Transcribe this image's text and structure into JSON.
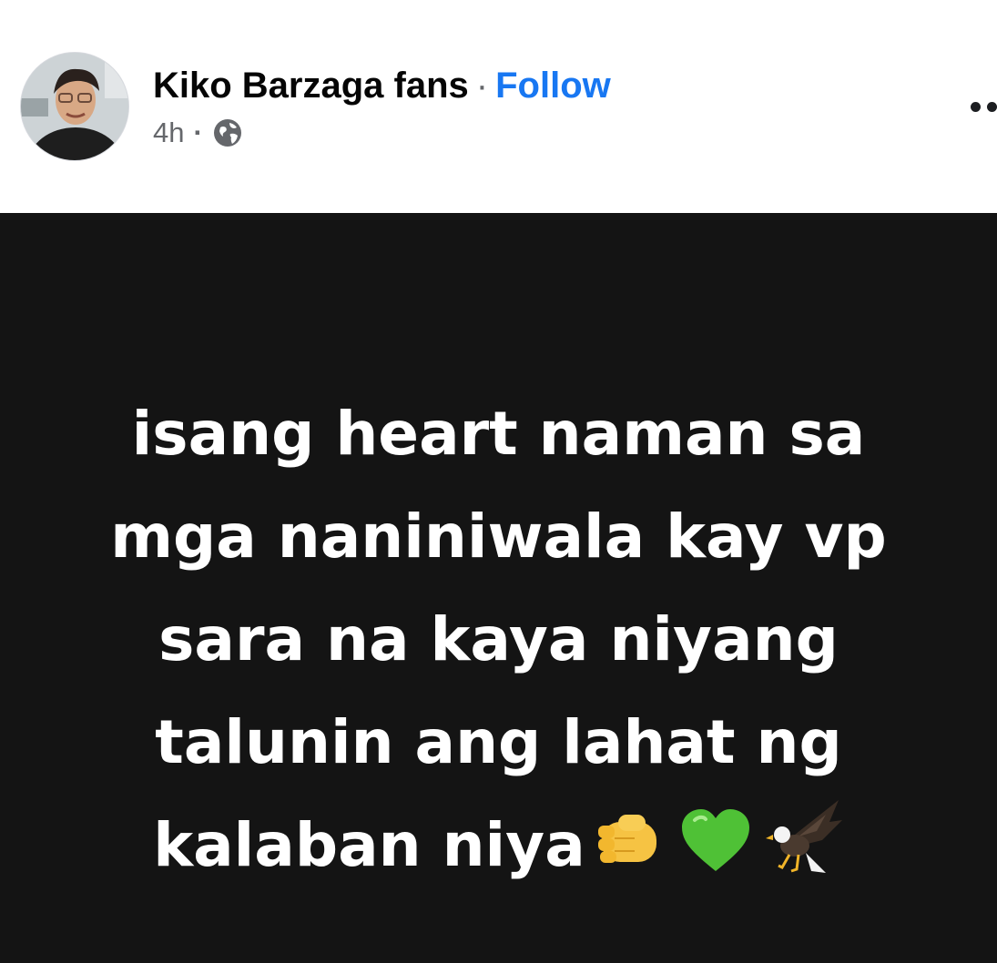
{
  "post": {
    "page_name": "Kiko Barzaga fans",
    "separator": "·",
    "follow_label": "Follow",
    "timestamp": "4h",
    "meta_dot": "·",
    "audience_icon": "globe-icon",
    "more_icon": "more-options-icon"
  },
  "content": {
    "lines": [
      "isang heart naman sa",
      "mga naniniwala kay vp",
      "sara na kaya niyang",
      "talunin ang lahat ng",
      "kalaban niya"
    ],
    "emojis": [
      "oncoming-fist-icon",
      "green-heart-icon",
      "eagle-icon"
    ]
  },
  "colors": {
    "accent": "#1877f2",
    "secondary_text": "#65676b",
    "post_background": "#141414",
    "post_text": "#ffffff"
  }
}
